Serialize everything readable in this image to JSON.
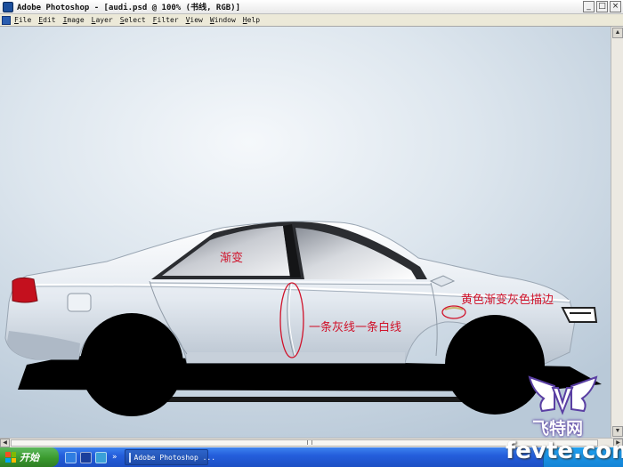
{
  "window": {
    "title": "Adobe Photoshop - [audi.psd @ 100% (书线, RGB)]",
    "controls": [
      "_",
      "□",
      "×"
    ]
  },
  "menu": {
    "items": [
      "File",
      "Edit",
      "Image",
      "Layer",
      "Select",
      "Filter",
      "View",
      "Window",
      "Help"
    ]
  },
  "canvas": {
    "annotations": {
      "gradient": "渐变",
      "lines": "一条灰线一条白线",
      "stroke": "黄色渐变灰色描边"
    }
  },
  "taskbar": {
    "start_label": "开始",
    "task_label": "Adobe Photoshop ...",
    "quick_launch_icons": [
      "ie-icon",
      "word-icon",
      "media-icon"
    ]
  },
  "watermark": {
    "logo_text_cn": "飞特网",
    "logo_text_en": "fevte.com"
  },
  "colors": {
    "annotation": "#d0122a",
    "taskbar": "#245edc",
    "start": "#3a9a2e"
  }
}
